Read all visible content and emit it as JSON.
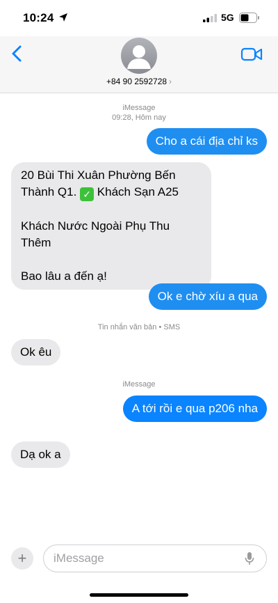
{
  "status_bar": {
    "time": "10:24",
    "network": "5G"
  },
  "header": {
    "contact": "+84 90 2592728",
    "chevron": "›",
    "back_icon": "chevron-left-icon",
    "video_icon": "video-camera-icon"
  },
  "thread": {
    "meta1_service": "iMessage",
    "meta1_time": "09:28, Hôm nay",
    "msg1": "Cho a cái địa chỉ ks",
    "msg2_line1": "20 Bùi Thi Xuân Phường Bến",
    "msg2_line2a": "Thành Q1. ",
    "msg2_line2b": " Khách Sạn A25",
    "msg2_line3": "Khách Nước Ngoài Phụ Thu Thêm",
    "msg2_line4": "Bao lâu a đến ạ!",
    "msg3": "Ok e chờ xíu a qua",
    "meta2": "Tin nhắn văn bản • SMS",
    "msg4": "Ok êu",
    "meta3": "iMessage",
    "msg5": "A tới rồi e qua p206 nha",
    "msg6": "Dạ ok a"
  },
  "composer": {
    "plus": "+",
    "placeholder": "iMessage",
    "mic_icon": "microphone-icon"
  },
  "colors": {
    "imessage_blue": "#1f8ef1",
    "received_gray": "#e9e9eb",
    "header_bg": "#f6f6f6",
    "accent": "#0a84ff"
  }
}
